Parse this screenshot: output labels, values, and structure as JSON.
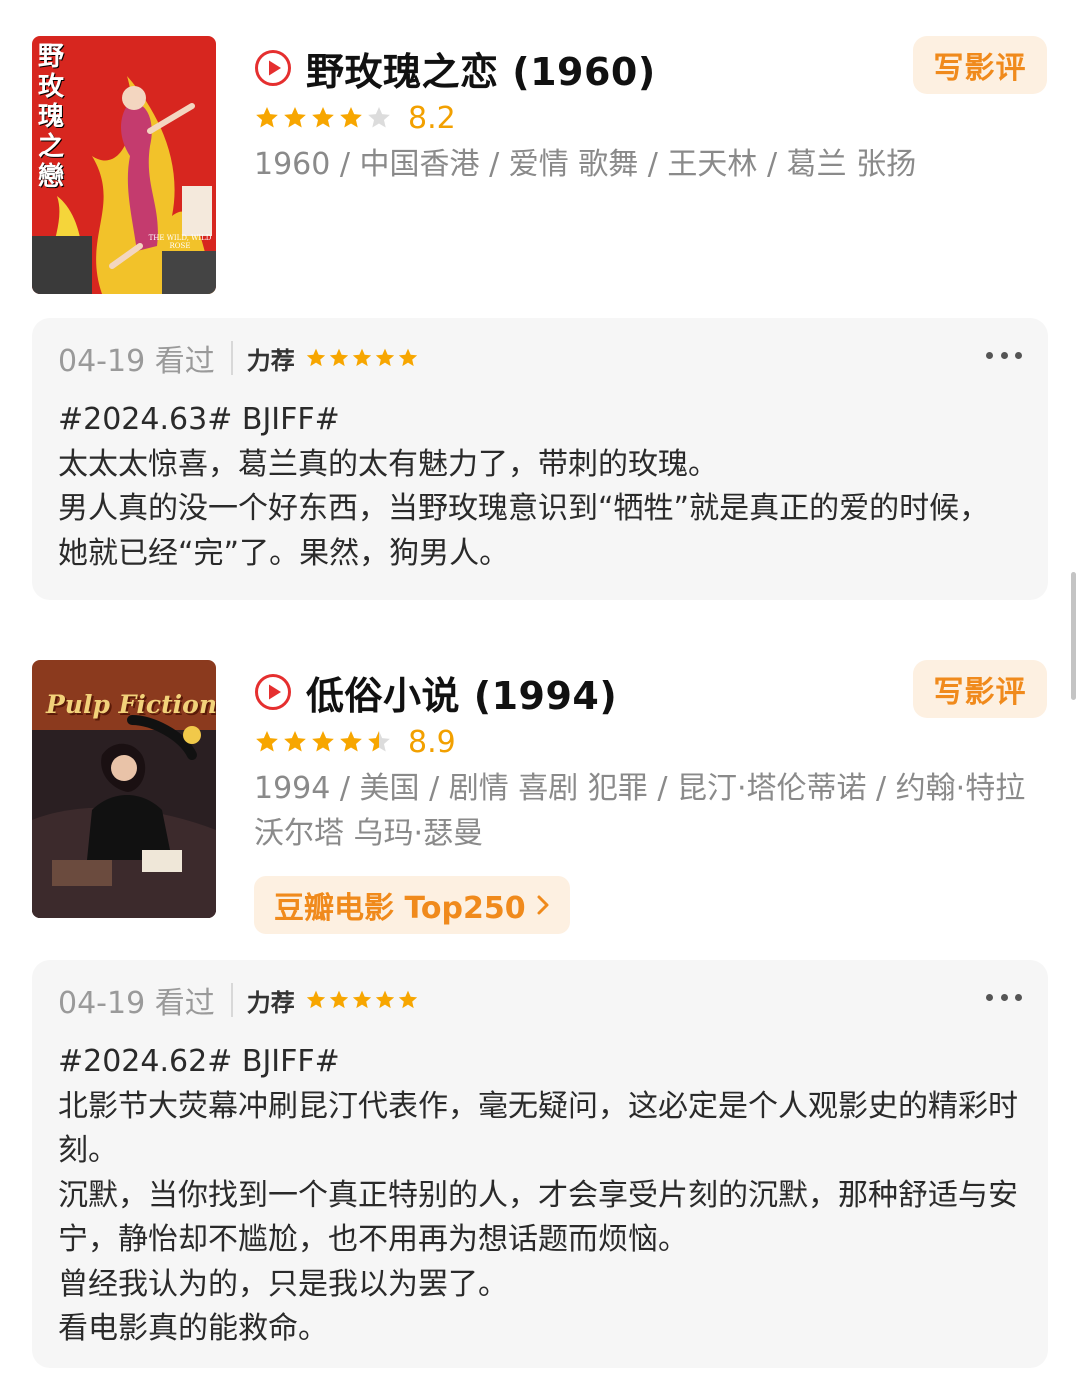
{
  "colors": {
    "accent_orange": "#f08a1c",
    "score_yellow": "#f2a000",
    "play_red": "#e52f2f",
    "card_bg": "#f6f6f6",
    "button_bg": "#fdf0e1"
  },
  "movies": [
    {
      "title": "野玫瑰之恋 (1960)",
      "star_rating": 4,
      "score": "8.2",
      "meta": "1960 / 中国香港 / 爱情 歌舞 / 王天林 / 葛兰 张扬",
      "review_button": "写影评",
      "poster_icon": "movie-poster-wild-wild-rose",
      "poster_text": {
        "chinese_title": "野玫瑰之戀",
        "english_title": "THE WILD, WILD ROSE"
      },
      "review": {
        "date": "04-19 看过",
        "rec_label": "力荐",
        "user_stars": 5,
        "lines": [
          "#2024.63# BJIFF#",
          "太太太惊喜，葛兰真的太有魅力了，带刺的玫瑰。",
          "男人真的没一个好东西，当野玫瑰意识到“牺牲”就是真正的爱的时候，她就已经“完”了。果然，狗男人。"
        ]
      }
    },
    {
      "title": "低俗小说 (1994)",
      "star_rating": 4.5,
      "score": "8.9",
      "meta": "1994 / 美国 / 剧情 喜剧 犯罪 / 昆汀·塔伦蒂诺 / 约翰·特拉沃尔塔 乌玛·瑟曼",
      "review_button": "写影评",
      "top_badge": "豆瓣电影 Top250",
      "poster_icon": "movie-poster-pulp-fiction",
      "poster_text": {
        "english_title": "Pulp Fiction"
      },
      "review": {
        "date": "04-19 看过",
        "rec_label": "力荐",
        "user_stars": 5,
        "lines": [
          "#2024.62# BJIFF#",
          "北影节大荧幕冲刷昆汀代表作，毫无疑问，这必定是个人观影史的精彩时刻。",
          "沉默，当你找到一个真正特别的人，才会享受片刻的沉默，那种舒适与安宁，静怡却不尴尬，也不用再为想话题而烦恼。",
          "曾经我认为的，只是我以为罢了。",
          "看电影真的能救命。"
        ]
      }
    }
  ]
}
